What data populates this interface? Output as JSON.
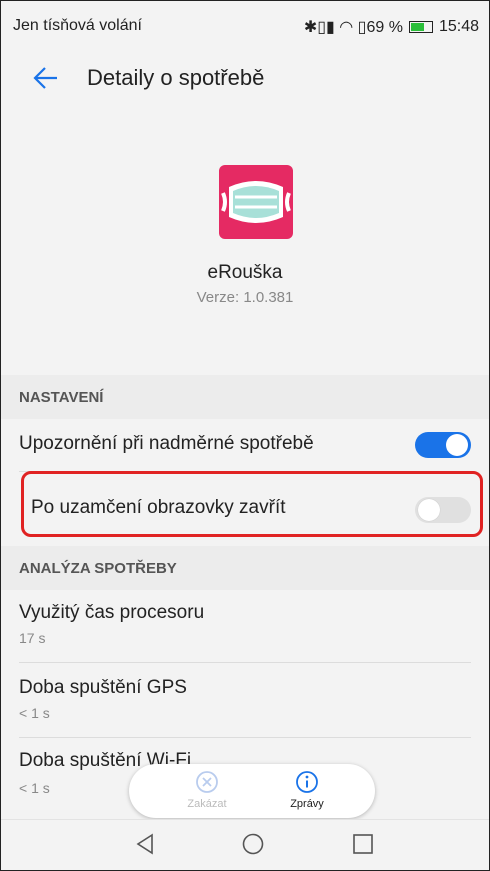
{
  "status_bar": {
    "carrier": "Jen tísňová volání",
    "right_text": "✱▯▮ ◠ ▯69 %",
    "time": "15:48"
  },
  "header": {
    "back_icon": "arrow-left-icon",
    "title": "Detaily o spotřebě",
    "accent": "#1a73e8"
  },
  "app": {
    "name": "eRouška",
    "version": "Verze: 1.0.381",
    "icon_color": "#e52a63"
  },
  "sections": {
    "settings_header": "NASTAVENÍ",
    "analysis_header": "ANALÝZA SPOTŘEBY"
  },
  "settings": [
    {
      "label": "Upozornění při nadměrné spotřebě",
      "enabled": true
    },
    {
      "label": "Po uzamčení obrazovky zavřít",
      "enabled": false
    }
  ],
  "analysis": [
    {
      "label": "Využitý čas procesoru",
      "value": "17 s"
    },
    {
      "label": "Doba spuštění GPS",
      "value": "< 1 s"
    },
    {
      "label": "Doba spuštění Wi-Fi",
      "value": "< 1 s"
    }
  ],
  "actions": {
    "disable_label": "Zakázat",
    "disable_icon": "close-circle-icon",
    "info_label": "Zprávy",
    "info_icon": "info-circle-icon"
  },
  "navbar": {
    "back": "nav-back-icon",
    "home": "nav-home-icon",
    "recents": "nav-recents-icon"
  },
  "colors": {
    "highlight": "#e02222",
    "toggle_on": "#1a73e8"
  }
}
